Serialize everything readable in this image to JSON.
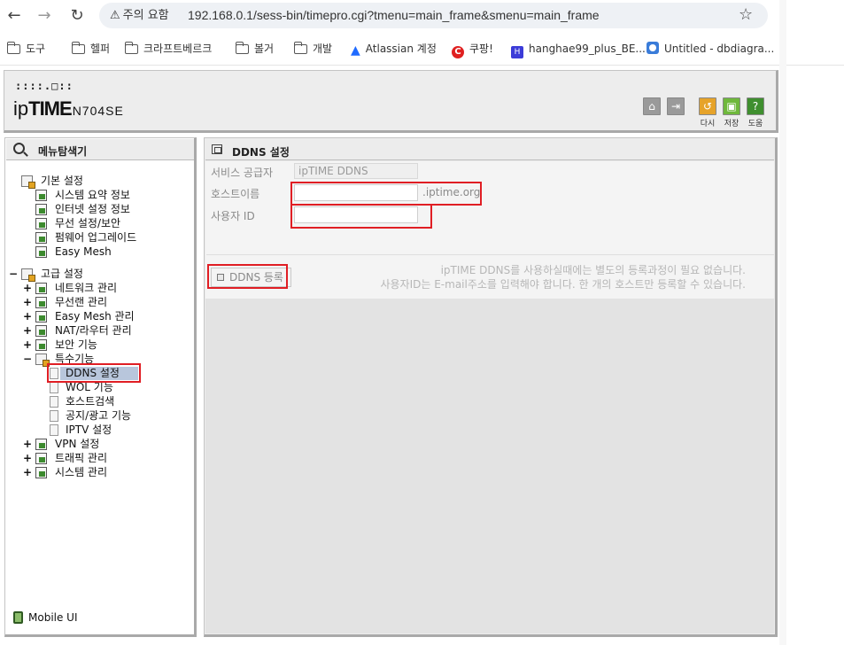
{
  "browser": {
    "nav": {
      "back": "←",
      "forward": "→",
      "reload": "↻"
    },
    "warning_label": "주의 요함",
    "url": "192.168.0.1/sess-bin/timepro.cgi?tmenu=main_frame&smenu=main_frame",
    "star_icon": "☆",
    "bookmarks": [
      {
        "label": "도구",
        "icon": "folder-icon"
      },
      {
        "label": "헬퍼",
        "icon": "folder-icon"
      },
      {
        "label": "크라프트베르크",
        "icon": "folder-icon"
      },
      {
        "label": "볼거",
        "icon": "folder-icon"
      },
      {
        "label": "개발",
        "icon": "folder-icon"
      },
      {
        "label": "Atlassian 계정",
        "icon": "atlassian-icon"
      },
      {
        "label": "쿠팡!",
        "icon": "coupang-icon"
      },
      {
        "label": "hanghae99_plus_BE...",
        "icon": "hanghae-icon"
      },
      {
        "label": "Untitled - dbdiagra...",
        "icon": "dbdiagram-icon"
      }
    ]
  },
  "router": {
    "logo_dots": "::::.□::",
    "brand_ip": "ip",
    "brand_time": "TIME",
    "model": "N704SE",
    "header_buttons": [
      {
        "name": "home",
        "glyph": "⌂",
        "label": ""
      },
      {
        "name": "logout",
        "glyph": "⇥",
        "label": ""
      },
      {
        "name": "restart",
        "glyph": "↺",
        "label": "다시"
      },
      {
        "name": "save",
        "glyph": "▣",
        "label": "저장"
      },
      {
        "name": "help",
        "glyph": "?",
        "label": "도움"
      }
    ],
    "colors": {
      "accent_red": "#e01e24",
      "restart": "#e6a32a",
      "save": "#6fb83c",
      "help": "#3f8f2f"
    }
  },
  "sidebar": {
    "title": "메뉴탐색기",
    "groups": [
      {
        "label": "기본 설정",
        "toggle": "",
        "items": [
          "시스템 요약 정보",
          "인터넷 설정 정보",
          "무선 설정/보안",
          "펌웨어 업그레이드",
          "Easy Mesh"
        ]
      },
      {
        "label": "고급 설정",
        "toggle": "−",
        "items": [
          {
            "label": "네트워크 관리",
            "toggle": "+"
          },
          {
            "label": "무선랜 관리",
            "toggle": "+"
          },
          {
            "label": "Easy Mesh 관리",
            "toggle": "+"
          },
          {
            "label": "NAT/라우터 관리",
            "toggle": "+"
          },
          {
            "label": "보안 기능",
            "toggle": "+"
          },
          {
            "label": "특수기능",
            "toggle": "−",
            "children": [
              "DDNS 설정",
              "WOL 기능",
              "호스트검색",
              "공지/광고 기능",
              "IPTV 설정"
            ]
          },
          {
            "label": "VPN 설정",
            "toggle": "+"
          },
          {
            "label": "트래픽 관리",
            "toggle": "+"
          },
          {
            "label": "시스템 관리",
            "toggle": "+"
          }
        ]
      }
    ],
    "mobile_label": "Mobile UI"
  },
  "content": {
    "title": "DDNS 설정",
    "form": {
      "provider_label": "서비스 공급자",
      "provider_value": "ipTIME DDNS",
      "hostname_label": "호스트이름",
      "hostname_value": "",
      "hostname_suffix": ".iptime.org",
      "user_label": "사용자 ID",
      "user_value": ""
    },
    "register_button": "DDNS 등록",
    "notice_line1": "ipTIME DDNS를 사용하실때에는 별도의 등록과정이 필요 없습니다.",
    "notice_line2": "사용자ID는 E-mail주소를 입력해야 합니다. 한 개의 호스트만 등록할 수 있습니다."
  }
}
